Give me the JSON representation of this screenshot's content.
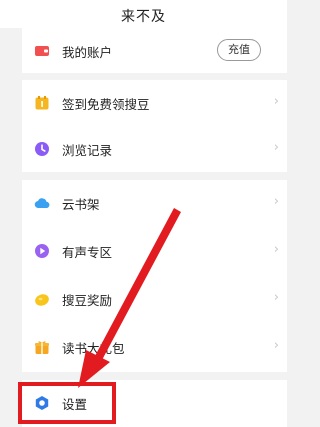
{
  "header": {
    "title": "来不及"
  },
  "account": {
    "label": "我的账户",
    "recharge_label": "充值"
  },
  "menu": {
    "items": [
      {
        "label": "签到免费领搜豆",
        "icon": "calendar-check-icon"
      },
      {
        "label": "浏览记录",
        "icon": "clock-icon"
      },
      {
        "label": "云书架",
        "icon": "cloud-icon"
      },
      {
        "label": "有声专区",
        "icon": "play-circle-icon"
      },
      {
        "label": "搜豆奖励",
        "icon": "coin-icon"
      },
      {
        "label": "读书大礼包",
        "icon": "gift-icon"
      },
      {
        "label": "设置",
        "icon": "settings-hexagon-icon"
      }
    ]
  },
  "annotation": {
    "highlight_color": "#e21b20"
  }
}
